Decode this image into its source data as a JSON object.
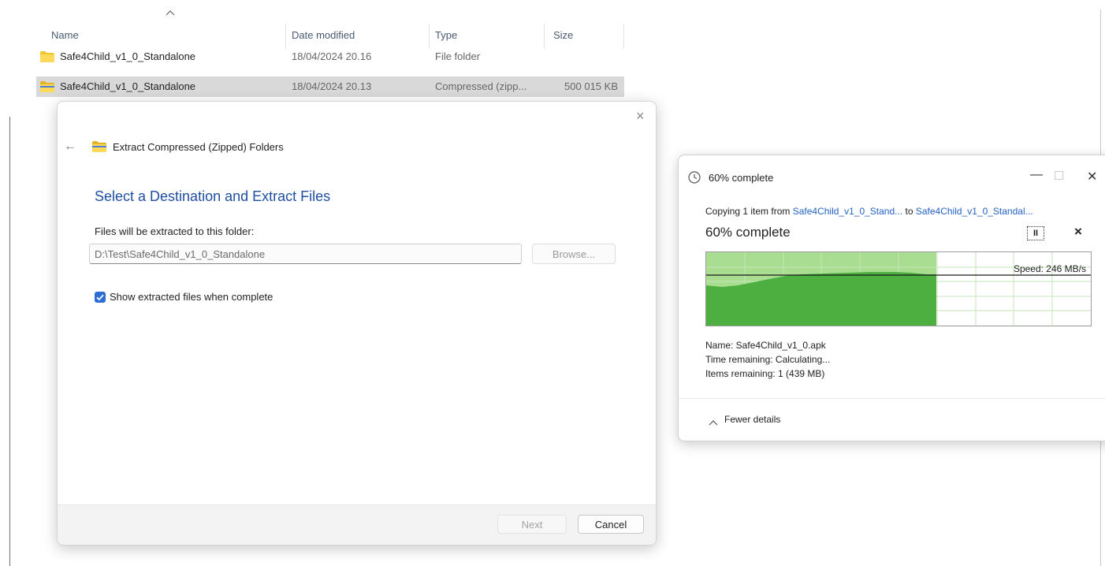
{
  "file_list": {
    "columns": {
      "name": "Name",
      "date_modified": "Date modified",
      "type": "Type",
      "size": "Size"
    },
    "sort_icon": "caret-up-icon",
    "rows": [
      {
        "name": "Safe4Child_v1_0_Standalone",
        "date": "18/04/2024 20.16",
        "type": "File folder",
        "size": "",
        "icon": "folder-icon"
      },
      {
        "name": "Safe4Child_v1_0_Standalone",
        "date": "18/04/2024 20.13",
        "type": "Compressed (zipp...",
        "size": "500 015 KB",
        "icon": "zip-folder-icon"
      }
    ]
  },
  "extract_dialog": {
    "title": "Extract Compressed (Zipped) Folders",
    "heading": "Select a Destination and Extract Files",
    "dest_label": "Files will be extracted to this folder:",
    "dest_value": "D:\\Test\\Safe4Child_v1_0_Standalone",
    "browse_label": "Browse...",
    "checkbox_label": "Show extracted files when complete",
    "checkbox_checked": true,
    "next_label": "Next",
    "cancel_label": "Cancel",
    "close_glyph": "×",
    "back_glyph": "←"
  },
  "progress": {
    "title": "60% complete",
    "copy_prefix": "Copying 1 item from ",
    "copy_src": "Safe4Child_v1_0_Stand...",
    "copy_mid": " to ",
    "copy_dst": "Safe4Child_v1_0_Standal...",
    "percent_text": "60% complete",
    "percent": 60,
    "speed_text": "Speed: 246 MB/s",
    "name_text": "Name:  Safe4Child_v1_0.apk",
    "time_text": "Time remaining:  Calculating...",
    "items_text": "Items remaining:  1 (439 MB)",
    "details_label": "Fewer details",
    "pause_glyph": "II",
    "cancel_glyph": "×",
    "minimize_glyph": "—",
    "maximize_glyph": "☐",
    "close_glyph": "✕",
    "colors": {
      "fill_dark": "#4caf3f",
      "fill_light": "#a8dd92",
      "grid": "#c6e6b8"
    }
  }
}
